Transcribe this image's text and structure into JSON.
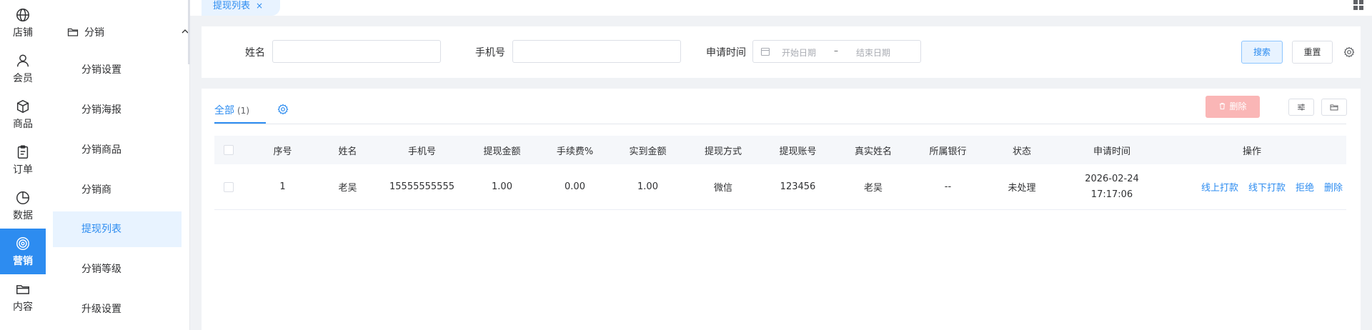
{
  "rail": {
    "items": [
      {
        "label": "店铺",
        "icon": "globe-icon"
      },
      {
        "label": "会员",
        "icon": "user-icon"
      },
      {
        "label": "商品",
        "icon": "box-icon"
      },
      {
        "label": "订单",
        "icon": "clipboard-icon"
      },
      {
        "label": "数据",
        "icon": "pie-chart-icon"
      },
      {
        "label": "营销",
        "icon": "target-icon",
        "active": true
      },
      {
        "label": "内容",
        "icon": "folder-icon"
      }
    ]
  },
  "submenu": {
    "group": "分销",
    "items": [
      "分销设置",
      "分销海报",
      "分销商品",
      "分销商",
      "提现列表",
      "分销等级",
      "升级设置"
    ],
    "active_index": 4
  },
  "tabs": {
    "active": "提现列表",
    "close": "×"
  },
  "filter": {
    "name_label": "姓名",
    "phone_label": "手机号",
    "date_label": "申请时间",
    "start_placeholder": "开始日期",
    "date_separator": "–",
    "end_placeholder": "结束日期",
    "search_button": "搜索",
    "reset_button": "重置"
  },
  "list": {
    "tab_label": "全部",
    "tab_count": "(1)",
    "delete_button": "删除",
    "columns": [
      "序号",
      "姓名",
      "手机号",
      "提现金额",
      "手续费%",
      "实到金额",
      "提现方式",
      "提现账号",
      "真实姓名",
      "所属银行",
      "状态",
      "申请时间",
      "操作"
    ],
    "rows": [
      {
        "index": "1",
        "name": "老吴",
        "phone": "15555555555",
        "amount": "1.00",
        "fee": "0.00",
        "received": "1.00",
        "method": "微信",
        "account": "123456",
        "real_name": "老吴",
        "bank": "--",
        "status": "未处理",
        "date": "2026-02-24",
        "time": "17:17:06",
        "actions": [
          "线上打款",
          "线下打款",
          "拒绝",
          "删除"
        ]
      }
    ]
  },
  "colors": {
    "primary": "#2d8cf0",
    "danger_disabled": "#fab6b6",
    "active_bg": "#e8f3ff"
  }
}
